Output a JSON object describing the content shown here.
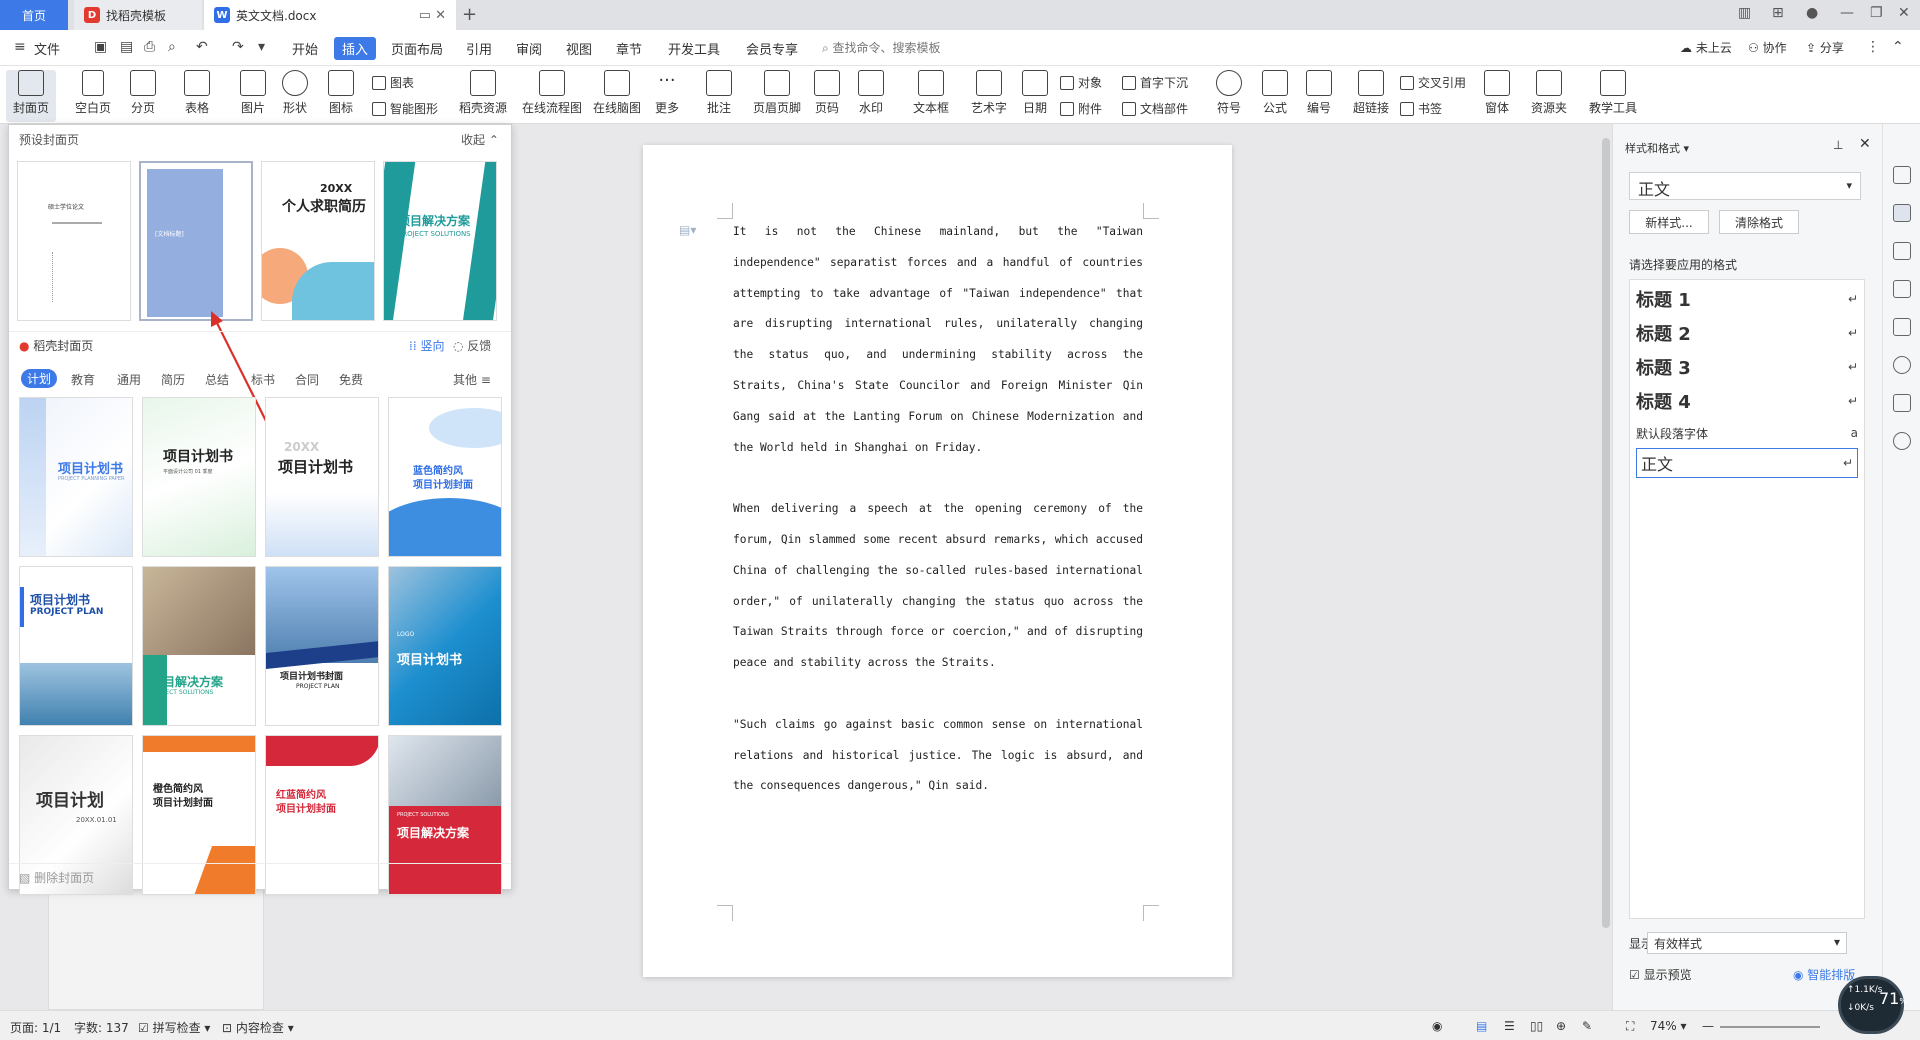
{
  "titlebar": {
    "tabs": [
      {
        "label": "首页"
      },
      {
        "label": "找稻壳模板"
      },
      {
        "label": "英文文档.docx"
      }
    ]
  },
  "menubar": {
    "file": "文件",
    "items": [
      "开始",
      "插入",
      "页面布局",
      "引用",
      "审阅",
      "视图",
      "章节",
      "开发工具",
      "会员专享"
    ],
    "active": "插入",
    "search_placeholder": "查找命令、搜索模板",
    "right": {
      "cloud": "未上云",
      "collab": "协作",
      "share": "分享"
    }
  },
  "ribbon": {
    "cover": "封面页",
    "blank": "空白页",
    "pagebreak": "分页",
    "table": "表格",
    "image": "图片",
    "shape": "形状",
    "icon": "图标",
    "chart": "图表",
    "smartart": "智能图形",
    "docer_res": "稻壳资源",
    "flowchart": "在线流程图",
    "mindmap": "在线脑图",
    "more": "更多",
    "comment": "批注",
    "header_footer": "页眉页脚",
    "page_num": "页码",
    "watermark": "水印",
    "textbox": "文本框",
    "wordart": "艺术字",
    "date": "日期",
    "object": "对象",
    "attachment": "附件",
    "dropcap": "首字下沉",
    "docpart": "文档部件",
    "symbol": "符号",
    "formula": "公式",
    "numbering": "编号",
    "hyperlink": "超链接",
    "crossref": "交叉引用",
    "bookmark": "书签",
    "window": "窗体",
    "resource": "资源夹",
    "teaching": "教学工具"
  },
  "cover_panel": {
    "header": "预设封面页",
    "collapse": "收起",
    "docer_header": "稻壳封面页",
    "vertical": "竖向",
    "feedback": "反馈",
    "categories": [
      "计划",
      "教育",
      "通用",
      "简历",
      "总结",
      "标书",
      "合同",
      "免费"
    ],
    "active_category": "计划",
    "other": "其他",
    "delete": "删除封面页",
    "presets": [
      {
        "title": "硕士学位论文"
      },
      {
        "title": "[文档标题]"
      },
      {
        "title": "个人求职简历",
        "sub": "20XX"
      },
      {
        "title": "项目解决方案",
        "sub": "PROJECT SOLUTIONS"
      }
    ],
    "templates": [
      {
        "title": "项目计划书",
        "sub": "PROJECT PLANNING PAPER"
      },
      {
        "title": "项目计划书",
        "sub": "平面设计公司 01 季度"
      },
      {
        "title": "项目计划书",
        "sub": "20XX"
      },
      {
        "title": "项目计划封面",
        "sub": "蓝色简约风"
      },
      {
        "title": "项目计划书",
        "sub": "PROJECT PLAN"
      },
      {
        "title": "项目解决方案",
        "sub": "PROJECT SOLUTIONS"
      },
      {
        "title": "项目计划书封面",
        "sub": "PROJECT PLAN"
      },
      {
        "title": "项目计划书",
        "sub": "LOGO"
      },
      {
        "title": "项目计划",
        "sub": "20XX.01.01"
      },
      {
        "title": "项目计划封面",
        "sub": "橙色简约风"
      },
      {
        "title": "项目计划封面",
        "sub": "红蓝简约风"
      },
      {
        "title": "项目解决方案",
        "sub": "PROJECT SOLUTIONS"
      }
    ],
    "colors": {
      "accent": "#3d7ae8",
      "arrow": "#d9302c"
    }
  },
  "document": {
    "paragraphs": [
      "It is not the Chinese mainland, but the \"Taiwan independence\" separatist forces and a handful of countries attempting to take advantage of \"Taiwan independence\" that are disrupting international rules, unilaterally changing the status quo, and undermining stability across the Straits, China's State Councilor and Foreign Minister Qin Gang said at the Lanting Forum on Chinese Modernization and the World held in Shanghai on Friday.",
      "When delivering a speech at the opening ceremony of the forum, Qin slammed some recent absurd remarks, which accused China of challenging the so-called rules-based international order,\" of unilaterally changing the status quo across the Taiwan Straits through force or coercion,\" and of disrupting peace and stability across the Straits.",
      "\"Such claims go against basic common sense on international relations and historical justice. The logic is absurd, and the consequences dangerous,\" Qin said."
    ]
  },
  "style_panel": {
    "title": "样式和格式",
    "current": "正文",
    "new_style": "新样式...",
    "clear": "清除格式",
    "prompt": "请选择要应用的格式",
    "styles": [
      {
        "name": "标题 1",
        "mark": "↵"
      },
      {
        "name": "标题 2",
        "mark": "↵"
      },
      {
        "name": "标题 3",
        "mark": "↵"
      },
      {
        "name": "标题 4",
        "mark": "↵"
      },
      {
        "name": "默认段落字体",
        "mark": "a"
      },
      {
        "name": "正文",
        "mark": "↵"
      }
    ],
    "show_label": "显示:",
    "show_value": "有效样式",
    "preview": "显示预览",
    "smart": "智能排版"
  },
  "statusbar": {
    "page": "页面: 1/1",
    "words": "字数: 137",
    "spell": "拼写检查",
    "content": "内容检查",
    "zoom": "74%"
  },
  "speed": {
    "up": "1.1K/s",
    "down": "0K/s",
    "percent": "71"
  }
}
